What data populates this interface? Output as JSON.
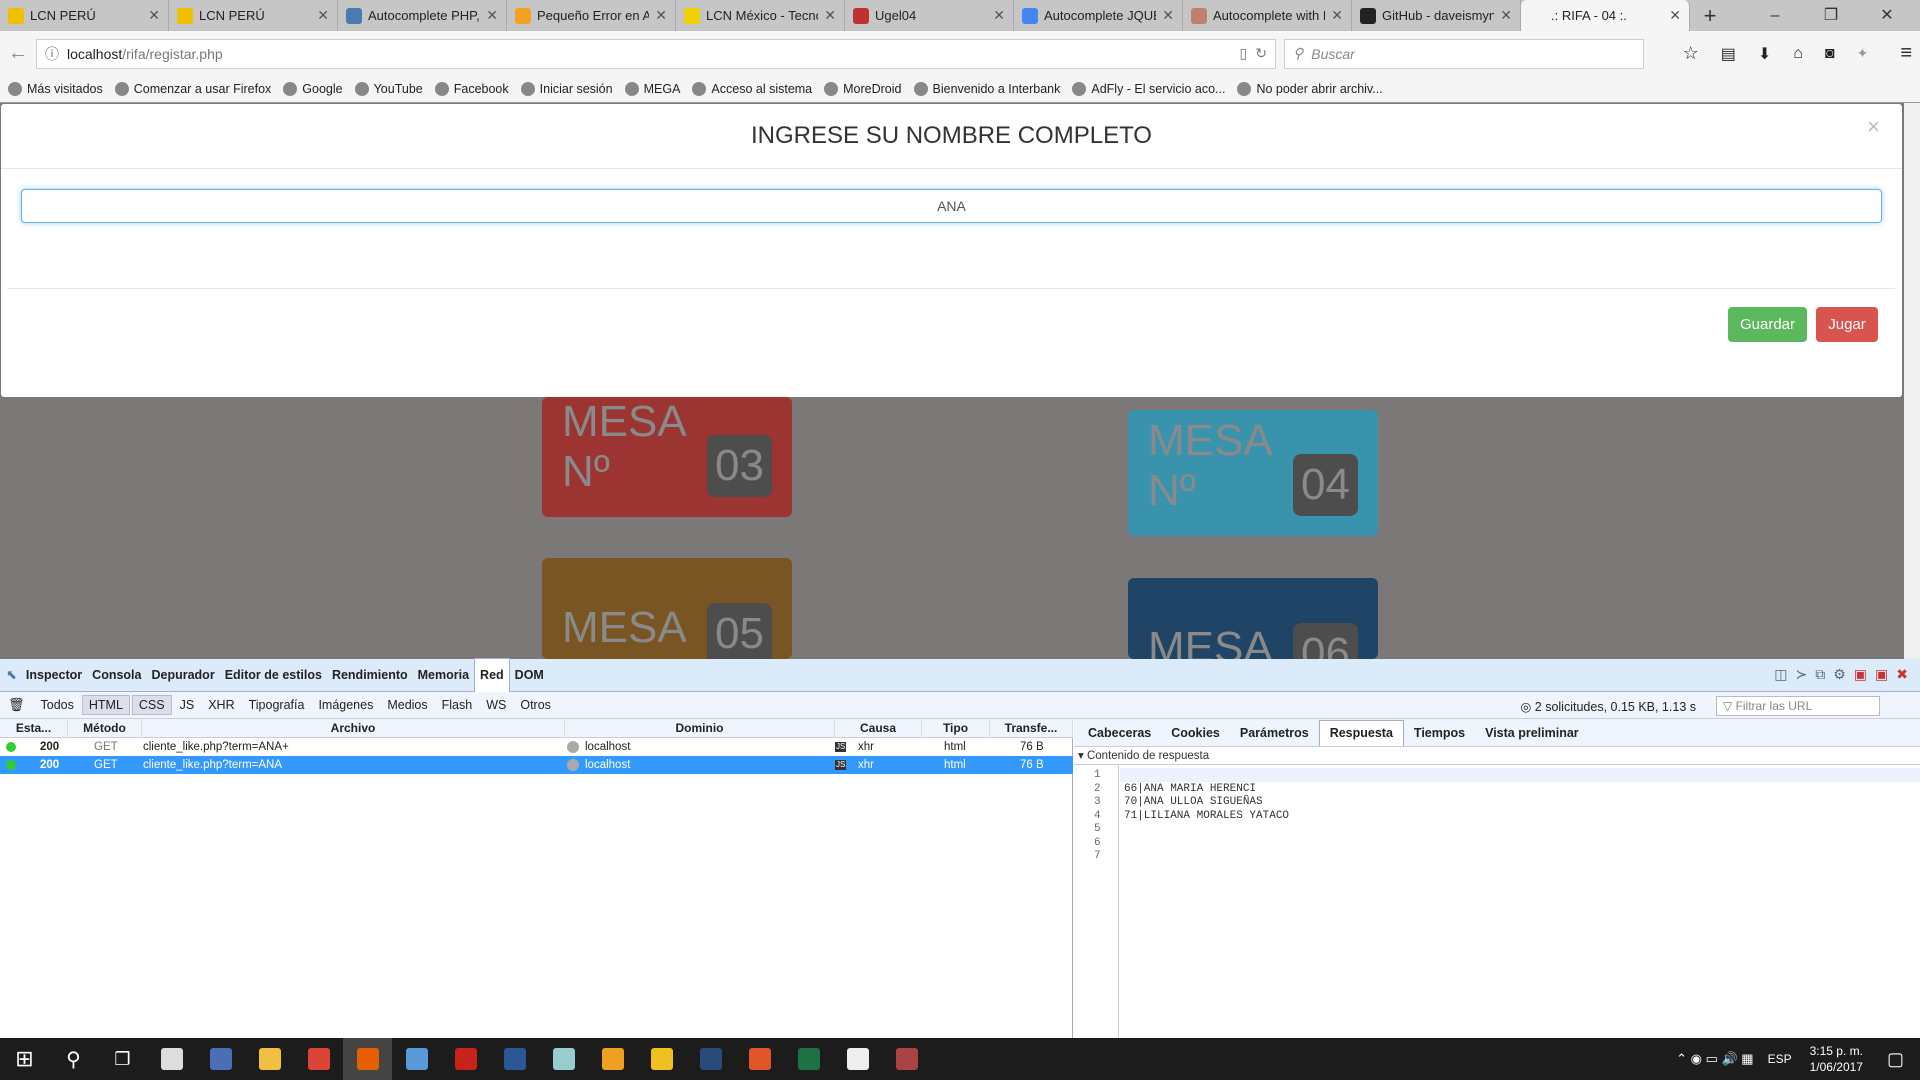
{
  "browser": {
    "tabs": [
      {
        "title": "LCN PERÚ",
        "color": "#f0c000"
      },
      {
        "title": "LCN PERÚ",
        "color": "#f0c000"
      },
      {
        "title": "Autocomplete PHP,",
        "color": "#4a7ab0"
      },
      {
        "title": "Pequeño Error en Au",
        "color": "#f4a020"
      },
      {
        "title": "LCN México - Tecno",
        "color": "#f0d000"
      },
      {
        "title": "Ugel04",
        "color": "#c03030"
      },
      {
        "title": "Autocomplete JQUERY",
        "color": "#4285f4"
      },
      {
        "title": "Autocomplete with P",
        "color": "#c08070"
      },
      {
        "title": "GitHub - daveismyna",
        "color": "#222222"
      },
      {
        "title": ".: RIFA - 04 :.",
        "color": "#f5f5f5",
        "active": true
      }
    ],
    "url_host": "localhost",
    "url_path": "/rifa/registar.php",
    "search_placeholder": "Buscar",
    "bookmarks": [
      "Más visitados",
      "Comenzar a usar Firefox",
      "Google",
      "YouTube",
      "Facebook",
      "Iniciar sesión",
      "MEGA",
      "Acceso al sistema",
      "MoreDroid",
      "Bienvenido a Interbank",
      "AdFly - El servicio aco...",
      "No poder abrir archiv..."
    ]
  },
  "page": {
    "cards": [
      {
        "label": "MESA Nº",
        "num": "03",
        "color": "#9c3532"
      },
      {
        "label": "MESA Nº",
        "num": "04",
        "color": "#3a93ad"
      },
      {
        "label": "MESA Nº",
        "num": "05",
        "color": "#7a5524"
      },
      {
        "label": "MESA Nº",
        "num": "06",
        "color": "#204466"
      }
    ],
    "modal": {
      "title": "INGRESE SU NOMBRE COMPLETO",
      "input_value": "ANA",
      "close": "×",
      "save": "Guardar",
      "play": "Jugar",
      "save_color": "#5cb85c",
      "play_color": "#d9534f"
    }
  },
  "devtools": {
    "tabs": [
      "Inspector",
      "Consola",
      "Depurador",
      "Editor de estilos",
      "Rendimiento",
      "Memoria",
      "Red",
      "DOM"
    ],
    "active_tab": "Red",
    "filters": [
      "Todos",
      "HTML",
      "CSS",
      "JS",
      "XHR",
      "Tipografía",
      "Imágenes",
      "Medios",
      "Flash",
      "WS",
      "Otros"
    ],
    "summary": "2 solicitudes, 0.15 KB, 1.13 s",
    "filter_placeholder": "Filtrar las URL",
    "columns": [
      "Esta...",
      "Método",
      "Archivo",
      "Dominio",
      "Causa",
      "Tipo",
      "Transfe..."
    ],
    "rows": [
      {
        "status": "200",
        "method": "GET",
        "file": "cliente_like.php?term=ANA+",
        "domain": "localhost",
        "cause": "xhr",
        "type": "html",
        "size": "76 B"
      },
      {
        "status": "200",
        "method": "GET",
        "file": "cliente_like.php?term=ANA",
        "domain": "localhost",
        "cause": "xhr",
        "type": "html",
        "size": "76 B",
        "selected": true
      }
    ],
    "detail_tabs": [
      "Cabeceras",
      "Cookies",
      "Parámetros",
      "Respuesta",
      "Tiempos",
      "Vista preliminar"
    ],
    "active_detail": "Respuesta",
    "section": "Contenido de respuesta",
    "lines": [
      "",
      "66|ANA MARIA HERENCI",
      "70|ANA ULLOA SIGUEÑAS",
      "71|LILIANA MORALES YATACO",
      "",
      "",
      ""
    ]
  },
  "taskbar": {
    "lang": "ESP",
    "time": "3:15 p. m.",
    "date": "1/06/2017"
  }
}
